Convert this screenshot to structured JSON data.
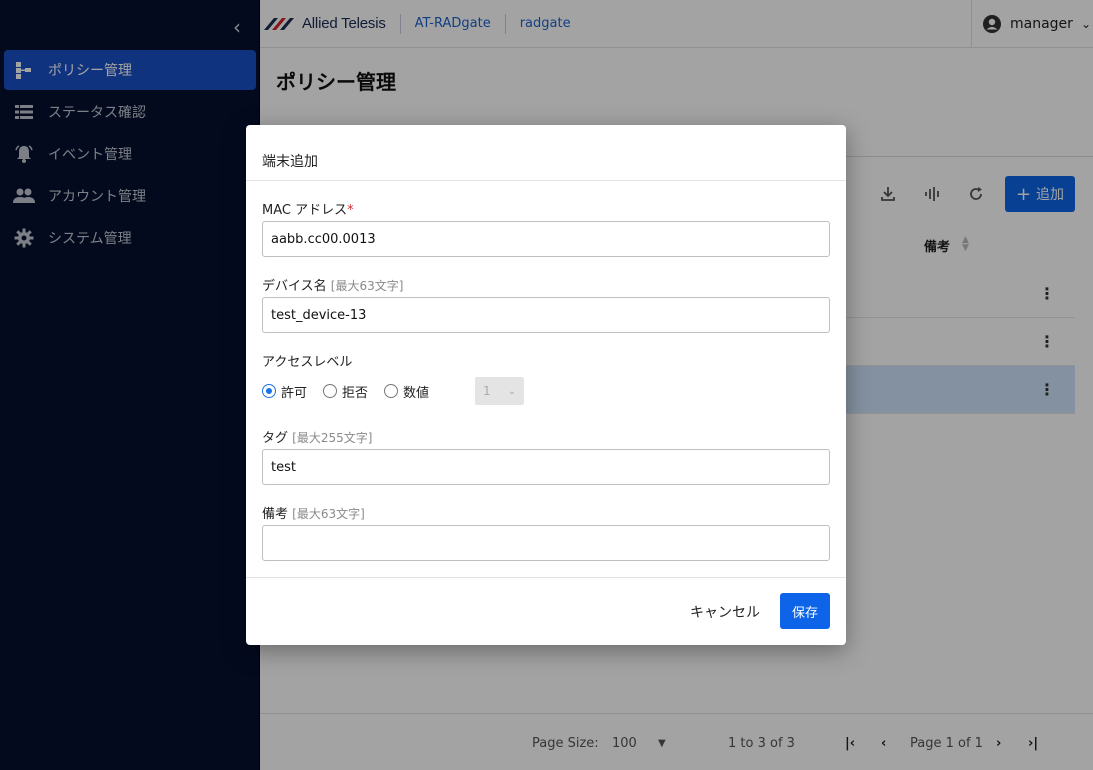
{
  "app": {
    "logo_text": "Allied Telesis",
    "breadcrumbs": [
      "AT-RADgate",
      "radgate"
    ],
    "user": "manager"
  },
  "sidebar": {
    "items": [
      {
        "label": "ポリシー管理",
        "icon": "policy-tree-icon",
        "active": true
      },
      {
        "label": "ステータス確認",
        "icon": "list-icon",
        "active": false
      },
      {
        "label": "イベント管理",
        "icon": "bell-icon",
        "active": false
      },
      {
        "label": "アカウント管理",
        "icon": "people-icon",
        "active": false
      },
      {
        "label": "システム管理",
        "icon": "gear-icon",
        "active": false
      }
    ]
  },
  "main": {
    "title": "ポリシー管理",
    "add_label": "追加",
    "column_note": "備考",
    "footer": {
      "page_size_label": "Page Size:",
      "page_size": "100",
      "range": "1 to 3 of 3",
      "page": "Page 1 of 1"
    }
  },
  "modal": {
    "title": "端末追加",
    "mac": {
      "label": "MAC アドレス",
      "required_mark": "*",
      "value": "aabb.cc00.0013"
    },
    "device": {
      "label": "デバイス名",
      "hint": "[最大63文字]",
      "value": "test_device-13"
    },
    "access": {
      "label": "アクセスレベル",
      "options": [
        "許可",
        "拒否",
        "数値"
      ],
      "selected": "許可",
      "numeric_value": "1"
    },
    "tag": {
      "label": "タグ",
      "hint": "[最大255文字]",
      "value": "test"
    },
    "note": {
      "label": "備考",
      "hint": "[最大63文字]",
      "value": ""
    },
    "cancel_label": "キャンセル",
    "save_label": "保存"
  },
  "colors": {
    "sidebar_bg": "#071130",
    "active_item": "#1a51c9",
    "primary": "#0d64e8"
  }
}
